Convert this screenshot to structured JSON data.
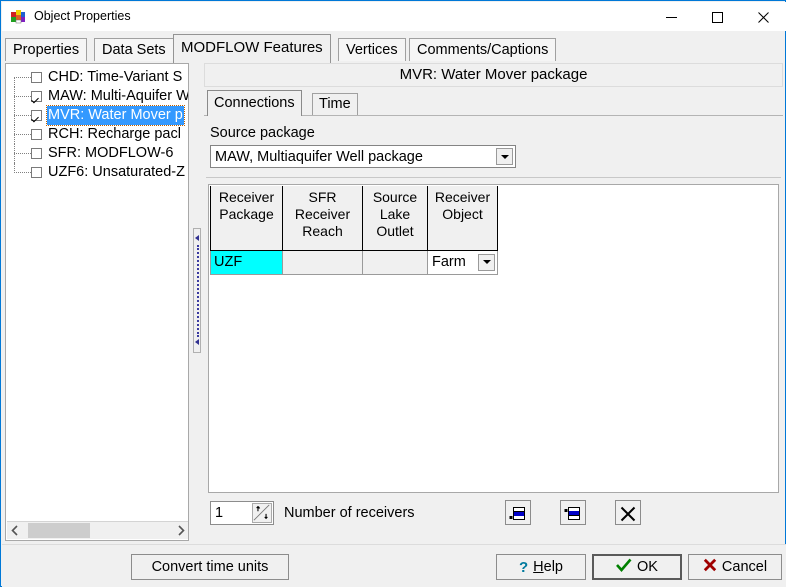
{
  "window": {
    "title": "Object Properties",
    "app_icon": "cube-icon",
    "controls": {
      "minimize": "minimize-icon",
      "maximize": "maximize-icon",
      "close": "close-icon"
    }
  },
  "tabs": [
    {
      "label": "Properties",
      "active": false
    },
    {
      "label": "Data Sets",
      "active": false
    },
    {
      "label": "MODFLOW Features",
      "active": true
    },
    {
      "label": "Vertices",
      "active": false
    },
    {
      "label": "Comments/Captions",
      "active": false
    }
  ],
  "tree": {
    "items": [
      {
        "label": "CHD: Time-Variant S",
        "checked": false,
        "selected": false
      },
      {
        "label": "MAW: Multi-Aquifer W",
        "checked": true,
        "selected": false
      },
      {
        "label": "MVR: Water Mover p",
        "checked": true,
        "selected": true
      },
      {
        "label": "RCH: Recharge pacl",
        "checked": false,
        "selected": false
      },
      {
        "label": "SFR: MODFLOW-6 ",
        "checked": false,
        "selected": false
      },
      {
        "label": "UZF6: Unsaturated-Z",
        "checked": false,
        "selected": false
      }
    ],
    "hscroll": {
      "left_arrow": "scroll-left-icon",
      "right_arrow": "scroll-right-icon"
    }
  },
  "package": {
    "header": "MVR: Water Mover package",
    "subtabs": [
      {
        "label": "Connections",
        "active": true
      },
      {
        "label": "Time",
        "active": false
      }
    ],
    "source_package": {
      "label": "Source package",
      "value": "MAW, Multiaquifer Well package",
      "caret": "chevron-down-icon"
    },
    "grid": {
      "columns": [
        "Receiver\nPackage",
        "SFR\nReceiver\nReach",
        "Source\nLake\nOutlet",
        "Receiver\nObject"
      ],
      "column_lines": [
        [
          "Receiver",
          "Package"
        ],
        [
          "SFR",
          "Receiver",
          "Reach"
        ],
        [
          "Source",
          "Lake",
          "Outlet"
        ],
        [
          "Receiver",
          "Object"
        ]
      ],
      "rows": [
        {
          "receiver_package": "UZF",
          "sfr_receiver_reach": "",
          "source_lake_outlet": "",
          "receiver_object": "Farm"
        }
      ],
      "highlight_color": "#00ffff"
    },
    "toolbar": {
      "spinner_value": "1",
      "spinner_up": "spin-up-icon",
      "spinner_down": "spin-down-icon",
      "receivers_label": "Number of receivers",
      "insert_after": "insert-row-after-icon",
      "insert_before": "insert-row-before-icon",
      "delete_row": "delete-row-icon"
    }
  },
  "footer": {
    "convert": "Convert time units",
    "help": "Help",
    "help_accel": "H",
    "help_icon": "question-mark-icon",
    "ok": "OK",
    "ok_icon": "check-icon",
    "cancel": "Cancel",
    "cancel_icon": "x-icon"
  },
  "colors": {
    "accent": "#0078d7",
    "selection": "#3399ff",
    "cyan": "#00ffff",
    "ok_green": "#008000",
    "cancel_red": "#a00000",
    "help_blue": "#007a9e"
  }
}
